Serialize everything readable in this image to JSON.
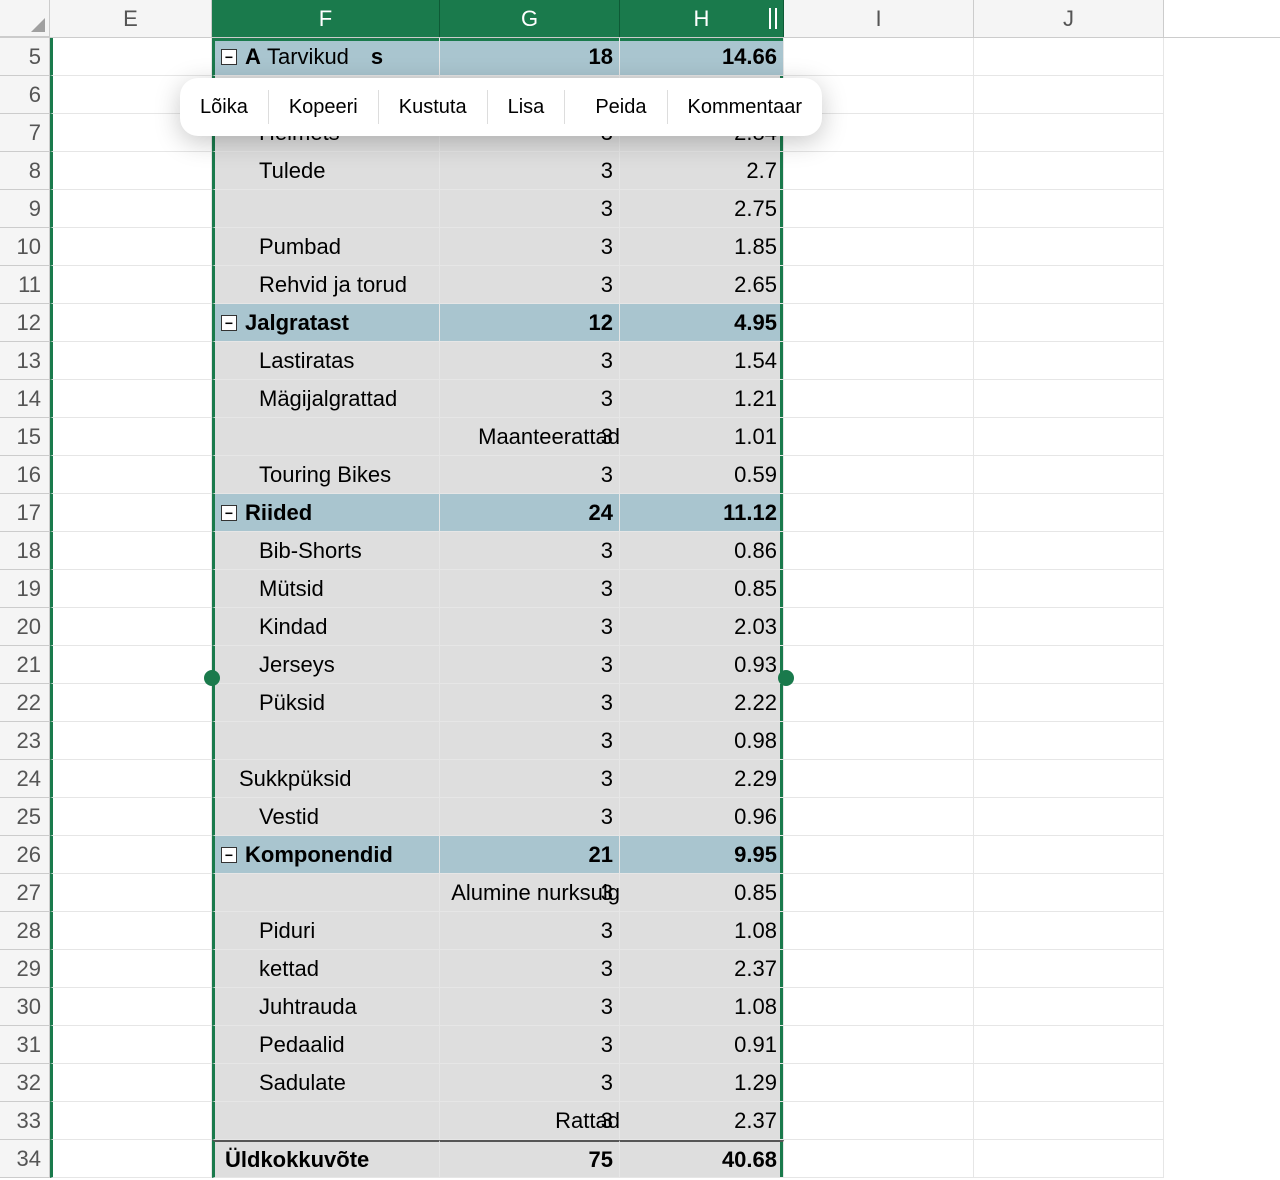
{
  "columns": [
    "E",
    "F",
    "G",
    "H",
    "I",
    "J"
  ],
  "selectedColumns": [
    "F",
    "G",
    "H"
  ],
  "context_menu": {
    "items": [
      "Lõika",
      "Kopeeri",
      "Kustuta",
      "Lisa",
      "Peida",
      "Kommentaar"
    ]
  },
  "rows": [
    {
      "n": 5,
      "type": "group",
      "F_partial": "A",
      "F_trailing": "s",
      "F_label": "Tarvikud",
      "G": "18",
      "H": "14.66"
    },
    {
      "n": 6,
      "type": "blank"
    },
    {
      "n": 7,
      "type": "child",
      "F": "Helmets",
      "G": "3",
      "H": "2.84"
    },
    {
      "n": 8,
      "type": "child",
      "F": "Tulede",
      "G": "3",
      "H": "2.7"
    },
    {
      "n": 9,
      "type": "child",
      "F": "",
      "G": "3",
      "H": "2.75"
    },
    {
      "n": 10,
      "type": "child",
      "F": "Pumbad",
      "G": "3",
      "H": "1.85"
    },
    {
      "n": 11,
      "type": "child",
      "F": "Rehvid ja torud",
      "G": "3",
      "H": "2.65"
    },
    {
      "n": 12,
      "type": "group",
      "F": "Jalgratast",
      "G": "12",
      "H": "4.95"
    },
    {
      "n": 13,
      "type": "child",
      "F": "Lastiratas",
      "G": "3",
      "H": "1.54"
    },
    {
      "n": 14,
      "type": "child",
      "F": "Mägijalgrattad",
      "G": "3",
      "H": "1.21"
    },
    {
      "n": 15,
      "type": "child",
      "F": "",
      "G": "3",
      "H": "1.01",
      "H_overflow": "Maanteerattad"
    },
    {
      "n": 16,
      "type": "child",
      "F": "Touring Bikes",
      "G": "3",
      "H": "0.59"
    },
    {
      "n": 17,
      "type": "group",
      "F": "Riided",
      "G": "24",
      "H": "11.12"
    },
    {
      "n": 18,
      "type": "child",
      "F": "Bib-Shorts",
      "G": "3",
      "H": "0.86"
    },
    {
      "n": 19,
      "type": "child",
      "F": "Mütsid",
      "G": "3",
      "H": "0.85"
    },
    {
      "n": 20,
      "type": "child",
      "F": "Kindad",
      "G": "3",
      "H": "2.03"
    },
    {
      "n": 21,
      "type": "child",
      "F": "Jerseys",
      "G": "3",
      "H": "0.93"
    },
    {
      "n": 22,
      "type": "child",
      "F": "Püksid",
      "G": "3",
      "H": "2.22"
    },
    {
      "n": 23,
      "type": "child",
      "F": "",
      "G": "3",
      "H": "0.98"
    },
    {
      "n": 24,
      "type": "child2",
      "F": "Sukkpüksid",
      "G": "3",
      "H": "2.29"
    },
    {
      "n": 25,
      "type": "child",
      "F": "Vestid",
      "G": "3",
      "H": "0.96"
    },
    {
      "n": 26,
      "type": "group",
      "F": "Komponendid",
      "G": "21",
      "H": "9.95"
    },
    {
      "n": 27,
      "type": "child",
      "F": "",
      "G": "3",
      "H": "0.85",
      "H_overflow": "Alumine nurksulg"
    },
    {
      "n": 28,
      "type": "child",
      "F": "Piduri",
      "G": "3",
      "H": "1.08"
    },
    {
      "n": 29,
      "type": "child",
      "F": "kettad",
      "G": "3",
      "H": "2.37"
    },
    {
      "n": 30,
      "type": "child",
      "F": "Juhtrauda",
      "G": "3",
      "H": "1.08"
    },
    {
      "n": 31,
      "type": "child",
      "F": "Pedaalid",
      "G": "3",
      "H": "0.91"
    },
    {
      "n": 32,
      "type": "child",
      "F": "Sadulate",
      "G": "3",
      "H": "1.29"
    },
    {
      "n": 33,
      "type": "child",
      "F": "",
      "G": "3",
      "H": "2.37",
      "H_overflow": "Rattad"
    },
    {
      "n": 34,
      "type": "total",
      "F": "Üldkokkuvõte",
      "G": "75",
      "H": "40.68"
    }
  ]
}
